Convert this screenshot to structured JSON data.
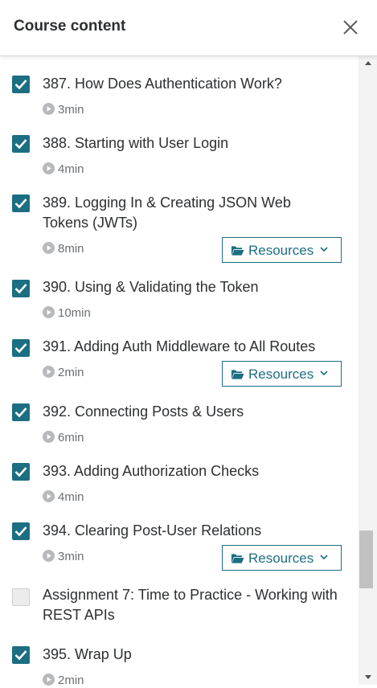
{
  "header": {
    "title": "Course content"
  },
  "resources_label": "Resources",
  "colors": {
    "accent": "#1c6e82"
  },
  "items": [
    {
      "title": "387. How Does Authentication Work?",
      "duration": "3min",
      "completed": true,
      "resources": false
    },
    {
      "title": "388. Starting with User Login",
      "duration": "4min",
      "completed": true,
      "resources": false
    },
    {
      "title": "389. Logging In & Creating JSON Web Tokens (JWTs)",
      "duration": "8min",
      "completed": true,
      "resources": true
    },
    {
      "title": "390. Using & Validating the Token",
      "duration": "10min",
      "completed": true,
      "resources": false
    },
    {
      "title": "391. Adding Auth Middleware to All Routes",
      "duration": "2min",
      "completed": true,
      "resources": true
    },
    {
      "title": "392. Connecting Posts & Users",
      "duration": "6min",
      "completed": true,
      "resources": false
    },
    {
      "title": "393. Adding Authorization Checks",
      "duration": "4min",
      "completed": true,
      "resources": false
    },
    {
      "title": "394. Clearing Post-User Relations",
      "duration": "3min",
      "completed": true,
      "resources": true
    },
    {
      "title": "Assignment 7: Time to Practice - Working with REST APIs",
      "duration": "",
      "completed": false,
      "resources": false
    },
    {
      "title": "395. Wrap Up",
      "duration": "2min",
      "completed": true,
      "resources": false
    }
  ]
}
